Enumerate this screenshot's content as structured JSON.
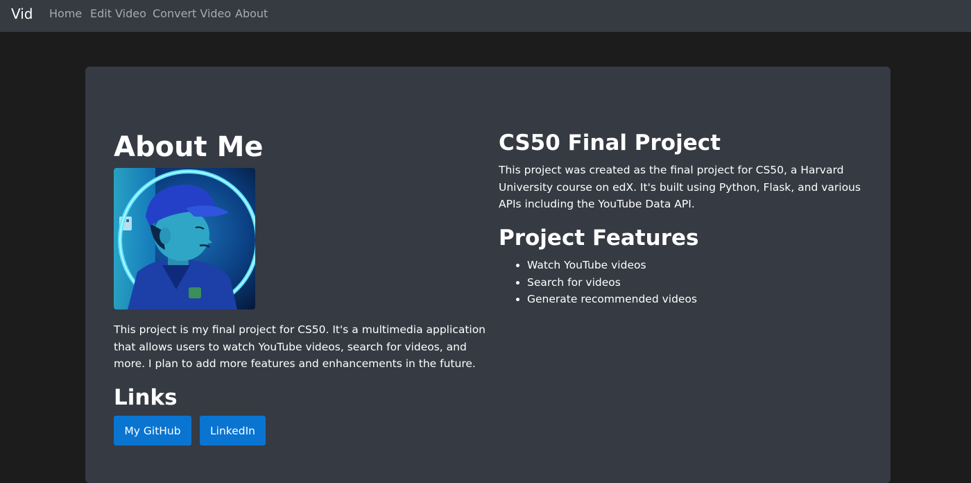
{
  "nav": {
    "brand": "Vid",
    "links": [
      {
        "label": "Home"
      },
      {
        "label": "Edit Video"
      },
      {
        "label": "Convert Video"
      },
      {
        "label": "About"
      }
    ]
  },
  "about": {
    "title": "About Me",
    "description": "This project is my final project for CS50. It's a multimedia application that allows users to watch YouTube videos, search for videos, and more. I plan to add more features and enhancements in the future.",
    "links_title": "Links",
    "buttons": [
      {
        "label": "My GitHub"
      },
      {
        "label": "LinkedIn"
      }
    ]
  },
  "project": {
    "title": "CS50 Final Project",
    "description": "This project was created as the final project for CS50, a Harvard University course on edX. It's built using Python, Flask, and various APIs including the YouTube Data API.",
    "features_title": "Project Features",
    "features": [
      "Watch YouTube videos",
      "Search for videos",
      "Generate recommended videos"
    ]
  },
  "colors": {
    "navbar_bg": "#363a41",
    "page_bg": "#1c1c1c",
    "card_bg": "#353a43",
    "button_bg": "#0a74d1",
    "nav_link": "#a7abb0"
  }
}
